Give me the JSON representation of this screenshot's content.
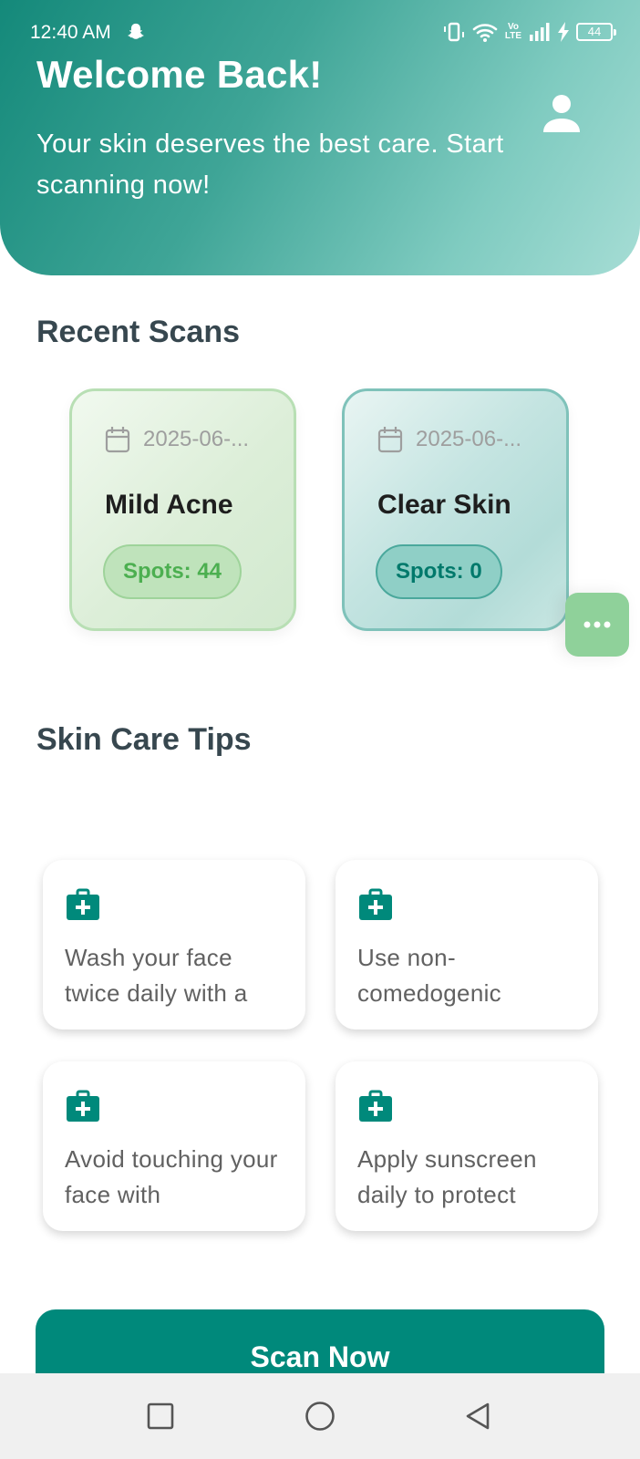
{
  "status_bar": {
    "time": "12:40 AM",
    "network_label": "Vo\nLTE",
    "battery": "44",
    "icons": [
      "snapchat-icon",
      "vibrate-icon",
      "wifi-icon",
      "volte-icon",
      "signal-icon",
      "charging-icon",
      "battery-icon"
    ]
  },
  "header": {
    "title": "Welcome Back!",
    "subtitle": "Your skin deserves the best care. Start scanning now!",
    "profile_icon": "person-icon"
  },
  "recent_scans": {
    "title": "Recent Scans",
    "items": [
      {
        "date": "2025-06-...",
        "title": "Mild Acne",
        "badge": "Spots: 44",
        "color": "#4caf50"
      },
      {
        "date": "2025-06-...",
        "title": "Clear Skin",
        "badge": "Spots: 0",
        "color": "#00796b"
      }
    ]
  },
  "tips": {
    "title": "Skin Care Tips",
    "icon": "medical-kit-icon",
    "items": [
      {
        "text": "Wash your face twice daily with a"
      },
      {
        "text": "Use non-comedogenic"
      },
      {
        "text": "Avoid touching your face with"
      },
      {
        "text": "Apply sunscreen daily to protect"
      }
    ]
  },
  "actions": {
    "scan_now": "Scan Now",
    "more_icon": "more-horizontal-icon"
  },
  "nav": {
    "icons": [
      "recents-square-icon",
      "home-circle-icon",
      "back-triangle-icon"
    ]
  },
  "colors": {
    "primary": "#00897b",
    "header_start": "#14897a",
    "header_end": "#a6ddd5",
    "heading": "#37474f",
    "acne_accent": "#4caf50",
    "float_button": "#8fd19a"
  }
}
